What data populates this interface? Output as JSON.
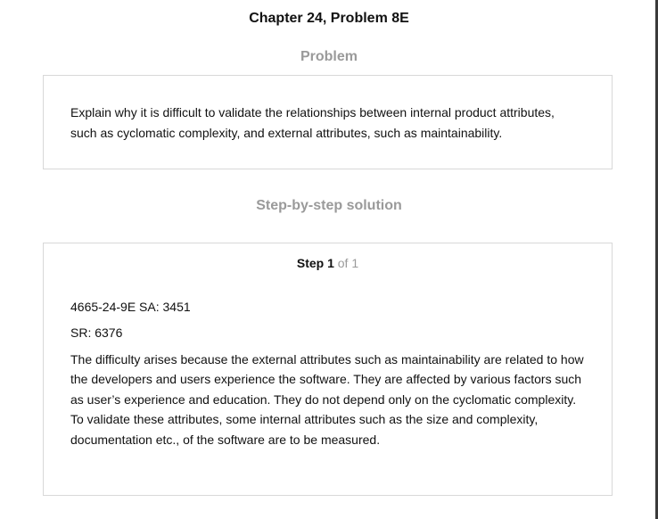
{
  "chapter_title": "Chapter 24, Problem 8E",
  "problem": {
    "heading": "Problem",
    "text": "Explain why it is difficult to validate the relationships between internal product attributes, such as cyclomatic complexity, and external attributes, such as maintainability."
  },
  "solution": {
    "heading": "Step-by-step solution",
    "step_word": "Step 1",
    "step_of": "of 1",
    "line1": "4665-24-9E SA: 3451",
    "line2": "SR: 6376",
    "paragraph": "The difficulty arises because the external attributes such as maintainability are related to how the developers and users experience the software. They are affected by various factors such as user’s experience and education. They do not depend only on the cyclomatic complexity. To validate these attributes, some internal attributes such as the size and complexity, documentation etc., of the software are to be measured."
  }
}
